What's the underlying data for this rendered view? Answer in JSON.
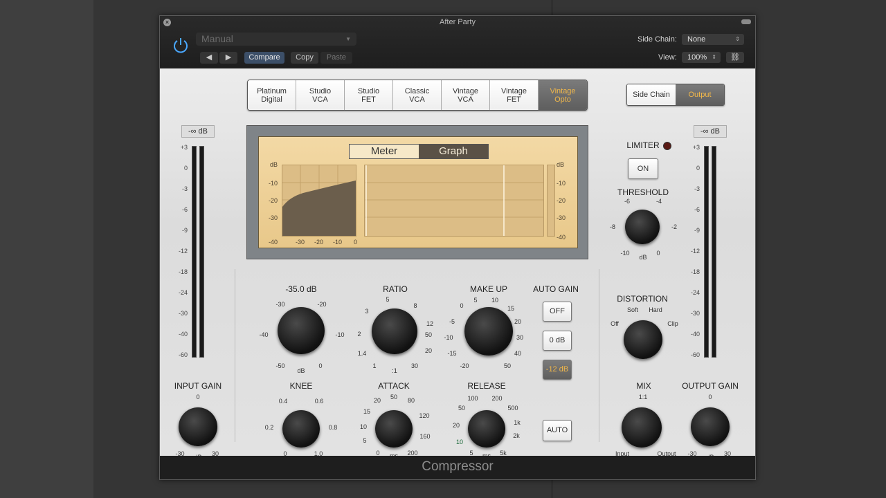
{
  "window": {
    "title": "After Party"
  },
  "header": {
    "preset": "Manual",
    "prev_label": "◀",
    "next_label": "▶",
    "compare_label": "Compare",
    "copy_label": "Copy",
    "paste_label": "Paste",
    "side_chain_label": "Side Chain:",
    "side_chain_value": "None",
    "view_label": "View:",
    "view_value": "100%"
  },
  "modes": [
    {
      "line1": "Platinum",
      "line2": "Digital"
    },
    {
      "line1": "Studio",
      "line2": "VCA"
    },
    {
      "line1": "Studio",
      "line2": "FET"
    },
    {
      "line1": "Classic",
      "line2": "VCA"
    },
    {
      "line1": "Vintage",
      "line2": "VCA"
    },
    {
      "line1": "Vintage",
      "line2": "FET"
    },
    {
      "line1": "Vintage",
      "line2": "Opto"
    }
  ],
  "selected_mode": 6,
  "sidechain_toggle": {
    "side_chain": "Side Chain",
    "output": "Output"
  },
  "input_meter": {
    "readout": "-∞ dB",
    "scale": [
      "+3",
      "0",
      "-3",
      "-6",
      "-9",
      "-12",
      "-18",
      "-24",
      "-30",
      "-40",
      "-60"
    ]
  },
  "output_meter": {
    "readout": "-∞ dB",
    "scale": [
      "+3",
      "0",
      "-3",
      "-6",
      "-9",
      "-12",
      "-18",
      "-24",
      "-30",
      "-40",
      "-60"
    ]
  },
  "display": {
    "tab_meter": "Meter",
    "tab_graph": "Graph",
    "y_left": [
      "dB",
      "-10",
      "-20",
      "-30",
      "-40"
    ],
    "x_axis": [
      "-30",
      "-20",
      "-10",
      "0"
    ],
    "y_right": [
      "dB",
      "-10",
      "-20",
      "-30",
      "-40"
    ]
  },
  "threshold": {
    "value": "-35.0 dB",
    "ticks": [
      "-30",
      "-20",
      "-40",
      "-10",
      "-50",
      "0"
    ],
    "unit": "dB"
  },
  "ratio": {
    "label": "RATIO",
    "ticks": [
      "5",
      "3",
      "8",
      "2",
      "12",
      "1.4",
      "20",
      "1",
      ":1",
      "30",
      "50"
    ]
  },
  "makeup": {
    "label": "MAKE UP",
    "ticks": [
      "5",
      "10",
      "0",
      "15",
      "-5",
      "20",
      "-10",
      "30",
      "-15",
      "40",
      "-20",
      "50"
    ]
  },
  "autogain": {
    "label": "AUTO GAIN",
    "off": "OFF",
    "zero": "0 dB",
    "minus12": "-12 dB"
  },
  "knee": {
    "label": "KNEE",
    "ticks": [
      "0.4",
      "0.6",
      "0.2",
      "0.8",
      "0",
      "1.0"
    ]
  },
  "attack": {
    "label": "ATTACK",
    "ticks": [
      "20",
      "50",
      "80",
      "15",
      "120",
      "10",
      "160",
      "5",
      "0",
      "200",
      "ms"
    ]
  },
  "release": {
    "label": "RELEASE",
    "ticks": [
      "100",
      "200",
      "50",
      "500",
      "20",
      "1k",
      "10",
      "2k",
      "5",
      "5k",
      "ms"
    ]
  },
  "auto_btn": "AUTO",
  "input_gain": {
    "label": "INPUT GAIN",
    "ticks": [
      "0",
      "-30",
      "dB",
      "30"
    ]
  },
  "limiter": {
    "label": "LIMITER",
    "on": "ON"
  },
  "limit_threshold": {
    "label": "THRESHOLD",
    "ticks": [
      "-6",
      "-4",
      "-8",
      "-2",
      "-10",
      "dB",
      "0"
    ]
  },
  "distortion": {
    "label": "DISTORTION",
    "ticks": [
      "Soft",
      "Hard",
      "Off",
      "Clip"
    ]
  },
  "mix": {
    "label": "MIX",
    "ticks": [
      "1:1",
      "Input",
      "Output"
    ]
  },
  "output_gain": {
    "label": "OUTPUT GAIN",
    "ticks": [
      "0",
      "-30",
      "dB",
      "30"
    ]
  },
  "footer": "Compressor"
}
